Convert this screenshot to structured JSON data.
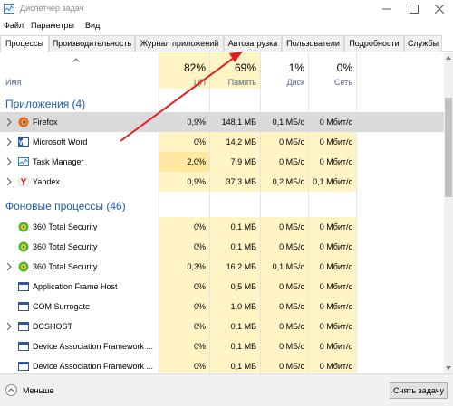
{
  "titlebar": {
    "title": "Диспетчер задач"
  },
  "menu": [
    "Файл",
    "Параметры",
    "Вид"
  ],
  "tabs": [
    "Процессы",
    "Производительность",
    "Журнал приложений",
    "Автозагрузка",
    "Пользователи",
    "Подробности",
    "Службы"
  ],
  "columns": {
    "name": "Имя",
    "cpu": {
      "pct": "82%",
      "label": "ЦП"
    },
    "mem": {
      "pct": "69%",
      "label": "Память"
    },
    "disk": {
      "pct": "1%",
      "label": "Диск"
    },
    "net": {
      "pct": "0%",
      "label": "Сеть"
    }
  },
  "sections": {
    "apps": "Приложения (4)",
    "bg": "Фоновые процессы (46)"
  },
  "apps": [
    {
      "name": "Firefox",
      "cpu": "0,9%",
      "mem": "148,1 МБ",
      "disk": "0,1 МБ/с",
      "net": "0 Мбит/с",
      "icon": "firefox-icon"
    },
    {
      "name": "Microsoft Word",
      "cpu": "0%",
      "mem": "14,2 МБ",
      "disk": "0 МБ/с",
      "net": "0 Мбит/с",
      "icon": "word-icon"
    },
    {
      "name": "Task Manager",
      "cpu": "2,0%",
      "mem": "7,9 МБ",
      "disk": "0 МБ/с",
      "net": "0 Мбит/с",
      "icon": "task-manager-icon"
    },
    {
      "name": "Yandex",
      "cpu": "0,9%",
      "mem": "37,3 МБ",
      "disk": "0,2 МБ/с",
      "net": "0,1 Мбит/с",
      "icon": "yandex-icon"
    }
  ],
  "bg": [
    {
      "name": "360 Total Security",
      "cpu": "0%",
      "mem": "0,1 МБ",
      "disk": "0 МБ/с",
      "net": "0 Мбит/с"
    },
    {
      "name": "360 Total Security",
      "cpu": "0%",
      "mem": "0,1 МБ",
      "disk": "0 МБ/с",
      "net": "0 Мбит/с"
    },
    {
      "name": "360 Total Security",
      "cpu": "0,3%",
      "mem": "16,2 МБ",
      "disk": "0,1 МБ/с",
      "net": "0 Мбит/с"
    },
    {
      "name": "Application Frame Host",
      "cpu": "0%",
      "mem": "0,5 МБ",
      "disk": "0 МБ/с",
      "net": "0 Мбит/с"
    },
    {
      "name": "COM Surrogate",
      "cpu": "0%",
      "mem": "1,0 МБ",
      "disk": "0 МБ/с",
      "net": "0 Мбит/с"
    },
    {
      "name": "DCSHOST",
      "cpu": "0%",
      "mem": "0,1 МБ",
      "disk": "0 МБ/с",
      "net": "0 Мбит/с"
    },
    {
      "name": "Device Association Framework ...",
      "cpu": "0%",
      "mem": "0,1 МБ",
      "disk": "0 МБ/с",
      "net": "0 Мбит/с"
    },
    {
      "name": "Device Association Framework ...",
      "cpu": "0%",
      "mem": "0,1 МБ",
      "disk": "0 МБ/с",
      "net": "0 Мбит/с"
    }
  ],
  "footer": {
    "less": "Меньше",
    "end_task": "Снять задачу"
  },
  "colors": {
    "heat_light": "#fff4c4",
    "heat_strong": "#ffe9a0",
    "section": "#1e5fa8",
    "annotation_arrow": "#e02020"
  }
}
